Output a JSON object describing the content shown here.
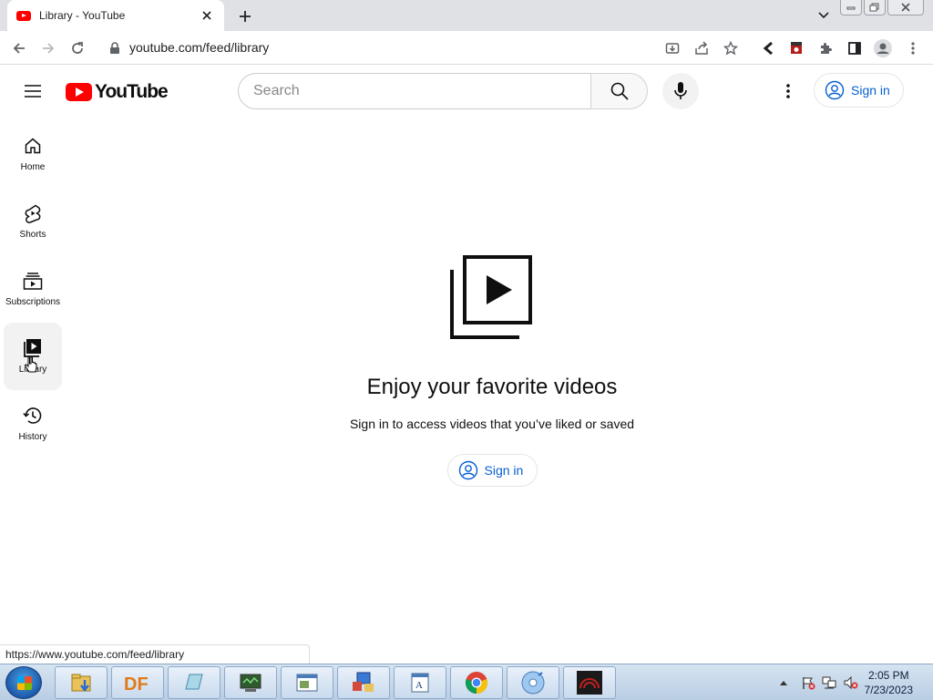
{
  "browser": {
    "tab_title": "Library - YouTube",
    "url": "youtube.com/feed/library",
    "status_url": "https://www.youtube.com/feed/library"
  },
  "header": {
    "logo_text": "YouTube",
    "search_placeholder": "Search",
    "signin_label": "Sign in"
  },
  "guide": {
    "items": [
      {
        "label": "Home",
        "icon": "home-icon"
      },
      {
        "label": "Shorts",
        "icon": "shorts-icon"
      },
      {
        "label": "Subscriptions",
        "icon": "subscriptions-icon"
      },
      {
        "label": "Library",
        "icon": "library-icon",
        "active": true
      },
      {
        "label": "History",
        "icon": "history-icon"
      }
    ]
  },
  "main": {
    "title": "Enjoy your favorite videos",
    "subtitle": "Sign in to access videos that you’ve liked or saved",
    "signin_label": "Sign in"
  },
  "taskbar": {
    "time": "2:05 PM",
    "date": "7/23/2023",
    "apps": [
      "file-explorer",
      "df",
      "app-3",
      "app-4",
      "app-5",
      "app-6",
      "app-7",
      "chrome",
      "media",
      "app-10"
    ]
  },
  "colors": {
    "brand_red": "#ff0000",
    "link_blue": "#065fd4"
  }
}
